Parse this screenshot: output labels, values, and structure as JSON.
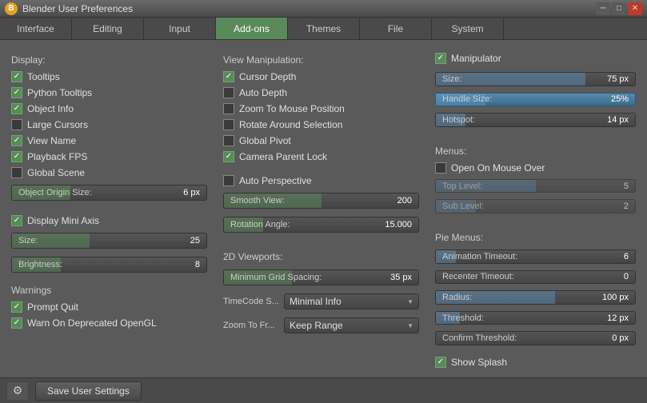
{
  "titleBar": {
    "title": "Blender User Preferences",
    "icon": "B"
  },
  "tabs": [
    {
      "label": "Interface",
      "active": false
    },
    {
      "label": "Editing",
      "active": false
    },
    {
      "label": "Input",
      "active": false
    },
    {
      "label": "Add-ons",
      "active": true
    },
    {
      "label": "Themes",
      "active": false
    },
    {
      "label": "File",
      "active": false
    },
    {
      "label": "System",
      "active": false
    }
  ],
  "col1": {
    "displayLabel": "Display:",
    "checkboxes": [
      {
        "label": "Tooltips",
        "checked": true
      },
      {
        "label": "Python Tooltips",
        "checked": true
      },
      {
        "label": "Object Info",
        "checked": true
      },
      {
        "label": "Large Cursors",
        "checked": false
      },
      {
        "label": "View Name",
        "checked": true
      },
      {
        "label": "Playback FPS",
        "checked": true
      },
      {
        "label": "Global Scene",
        "checked": false
      }
    ],
    "objectOriginLabel": "Object Origin Size:",
    "objectOriginValue": "6 px",
    "displayMiniAxisLabel": "Display Mini Axis",
    "displayMiniAxisChecked": true,
    "sizeLabel": "Size:",
    "sizeValue": "25",
    "brightnessLabel": "Brightness:",
    "brightnessValue": "8",
    "warningsLabel": "Warnings",
    "warningCheckboxes": [
      {
        "label": "Prompt Quit",
        "checked": true
      },
      {
        "label": "Warn On Deprecated OpenGL",
        "checked": true
      }
    ]
  },
  "col2": {
    "viewManipLabel": "View Manipulation:",
    "vmCheckboxes": [
      {
        "label": "Cursor Depth",
        "checked": true
      },
      {
        "label": "Auto Depth",
        "checked": false
      },
      {
        "label": "Zoom To Mouse Position",
        "checked": false
      },
      {
        "label": "Rotate Around Selection",
        "checked": false
      },
      {
        "label": "Global Pivot",
        "checked": false
      },
      {
        "label": "Camera Parent Lock",
        "checked": true
      }
    ],
    "autoPerspLabel": "Auto Perspective",
    "autoPerspChecked": false,
    "smoothViewLabel": "Smooth View:",
    "smoothViewValue": "200",
    "rotationAngleLabel": "Rotation Angle:",
    "rotationAngleValue": "15.000",
    "viewports2dLabel": "2D Viewports:",
    "minGridLabel": "Minimum Grid Spacing:",
    "minGridValue": "35 px",
    "timeCodeLabel": "TimeCode S...",
    "timeCodeValue": "Minimal Info",
    "zoomToFrLabel": "Zoom To Fr...",
    "zoomToFrValue": "Keep Range"
  },
  "col3": {
    "manipulatorLabel": "Manipulator",
    "manipulatorChecked": true,
    "sizeLabel": "Size:",
    "sizeValue": "75 px",
    "handleSizeLabel": "Handle Size:",
    "handleSizeValue": "25%",
    "hotspotLabel": "Hotspot:",
    "hotspotValue": "14 px",
    "menusLabel": "Menus:",
    "openOnMouseOverLabel": "Open On Mouse Over",
    "openOnMouseOverChecked": false,
    "topLevelLabel": "Top Level:",
    "topLevelValue": "5",
    "subLevelLabel": "Sub Level:",
    "subLevelValue": "2",
    "pieMenusLabel": "Pie Menus:",
    "animationTimeoutLabel": "Animation Timeout:",
    "animationTimeoutValue": "6",
    "recenterTimeoutLabel": "Recenter Timeout:",
    "recenterTimeoutValue": "0",
    "radiusLabel": "Radius:",
    "radiusValue": "100 px",
    "thresholdLabel": "Threshold:",
    "thresholdValue": "12 px",
    "confirmThresholdLabel": "Confirm Threshold:",
    "confirmThresholdValue": "0 px",
    "showSplashLabel": "Show Splash",
    "showSplashChecked": true
  },
  "footer": {
    "saveLabel": "Save User Settings"
  }
}
